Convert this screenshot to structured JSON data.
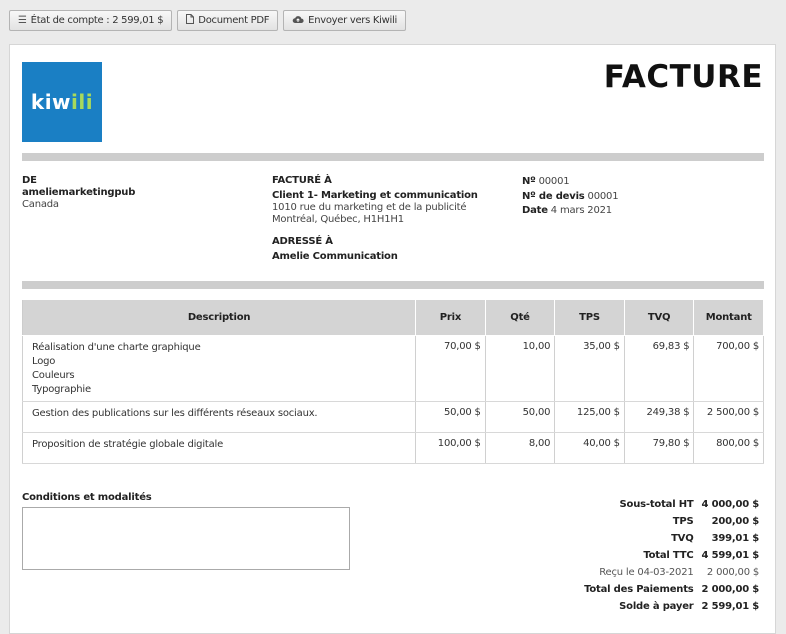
{
  "toolbar": {
    "account_label": "État de compte : 2 599,01 $",
    "pdf_label": "Document PDF",
    "send_label": "Envoyer vers Kiwili"
  },
  "logo": {
    "part1": "kiw",
    "part2": "ili"
  },
  "invoice": {
    "title": "FACTURE",
    "from": {
      "heading": "DE",
      "name": "ameliemarketingpub",
      "country": "Canada"
    },
    "bill_to": {
      "heading": "FACTURÉ À",
      "name": "Client 1- Marketing et communication",
      "address1": "1010 rue du marketing et de la publicité",
      "address2": "Montréal, Québec, H1H1H1"
    },
    "ship_to": {
      "heading": "ADRESSÉ À",
      "name": "Amelie Communication"
    },
    "meta": {
      "number_label": "Nº",
      "number": "00001",
      "quote_label": "Nº de devis",
      "quote": "00001",
      "date_label": "Date",
      "date": "4 mars 2021"
    }
  },
  "table": {
    "headers": [
      "Description",
      "Prix",
      "Qté",
      "TPS",
      "TVQ",
      "Montant"
    ],
    "rows": [
      {
        "desc": [
          "Réalisation d'une charte graphique",
          "Logo",
          "Couleurs",
          "Typographie"
        ],
        "price": "70,00 $",
        "qty": "10,00",
        "tps": "35,00 $",
        "tvq": "69,83 $",
        "amount": "700,00 $"
      },
      {
        "desc": [
          "Gestion des publications sur les différents réseaux sociaux."
        ],
        "price": "50,00 $",
        "qty": "50,00",
        "tps": "125,00 $",
        "tvq": "249,38 $",
        "amount": "2 500,00 $"
      },
      {
        "desc": [
          "Proposition de stratégie globale digitale"
        ],
        "price": "100,00 $",
        "qty": "8,00",
        "tps": "40,00 $",
        "tvq": "79,80 $",
        "amount": "800,00 $"
      }
    ]
  },
  "conditions": {
    "label": "Conditions et modalités"
  },
  "totals": [
    {
      "label": "Sous-total HT",
      "value": "4 000,00 $",
      "light": false
    },
    {
      "label": "TPS",
      "value": "200,00 $",
      "light": false
    },
    {
      "label": "TVQ",
      "value": "399,01 $",
      "light": false
    },
    {
      "label": "Total TTC",
      "value": "4 599,01 $",
      "light": false
    },
    {
      "label": "Reçu le 04-03-2021",
      "value": "2 000,00 $",
      "light": true
    },
    {
      "label": "Total des Paiements",
      "value": "2 000,00 $",
      "light": false
    },
    {
      "label": "Solde à payer",
      "value": "2 599,01 $",
      "light": false
    }
  ],
  "colors": {
    "logo_bg": "#1a7fc4",
    "logo_accent": "#a8d95c",
    "band": "#cdcdcd",
    "header_bg": "#d4d4d4"
  }
}
